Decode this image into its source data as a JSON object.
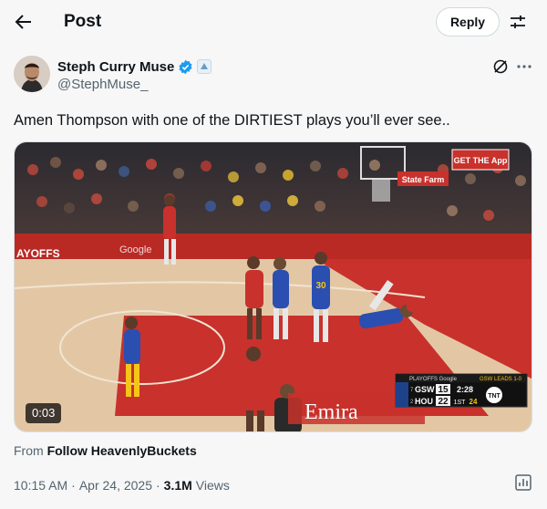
{
  "header": {
    "title": "Post",
    "reply_label": "Reply",
    "back_icon": "arrow-left-icon",
    "filter_icon": "sliders-icon"
  },
  "author": {
    "display_name": "Steph Curry Muse",
    "handle": "@StephMuse_",
    "verified_color": "#1d9bf0"
  },
  "tweet": {
    "text": "Amen Thompson with one of the DIRTIEST plays you’ll ever see.."
  },
  "media": {
    "duration": "0:03",
    "scene": {
      "sign_top_right": "GET THE App",
      "sign_statefarm": "State Farm",
      "banner_left": "AYOFFS",
      "banner_google": "Google",
      "floor_text": "Emira",
      "scorebug": {
        "header_left": "PLAYOFFS  Google",
        "header_right": "GSW LEADS 1-0",
        "team1": "GSW",
        "seed1": "7",
        "score1": "15",
        "team2": "HOU",
        "seed2": "2",
        "score2": "22",
        "clock": "2:28",
        "period": "1ST",
        "shot_clock": "24",
        "network": "TNT"
      }
    }
  },
  "source": {
    "prefix": "From",
    "link": "Follow HeavenlyBuckets"
  },
  "meta": {
    "time": "10:15 AM",
    "sep1": "·",
    "date": "Apr 24, 2025",
    "sep2": "·",
    "views_count": "3.1M",
    "views_label": "Views"
  },
  "colors": {
    "text": "#0f1419",
    "secondary": "#536471",
    "court_red": "#c8312c",
    "court_wood": "#e3c7a5",
    "gsw_blue": "#2a4fb0",
    "gsw_gold": "#f5c518"
  }
}
